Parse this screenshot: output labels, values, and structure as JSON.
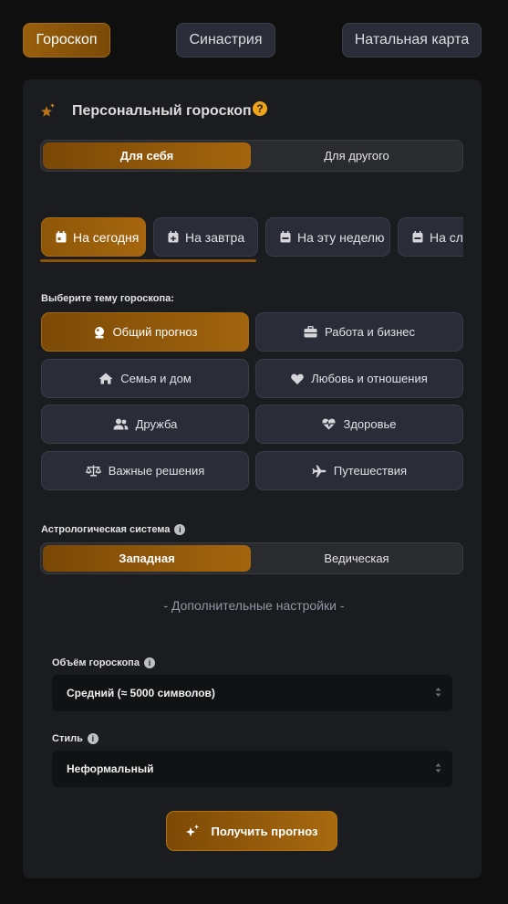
{
  "top_tabs": [
    "Гороскоп",
    "Синастрия",
    "Натальная карта"
  ],
  "card_title": "Персональный гороскоп",
  "help_icon": "?",
  "target_toggle": {
    "self": "Для себя",
    "other": "Для другого"
  },
  "date_tabs": [
    "На сегодня",
    "На завтра",
    "На эту неделю",
    "На сле"
  ],
  "topic_label": "Выберите тему гороскопа:",
  "topics": [
    {
      "label": "Общий прогноз",
      "icon": "crystal-ball-icon"
    },
    {
      "label": "Работа и бизнес",
      "icon": "briefcase-icon"
    },
    {
      "label": "Семья и дом",
      "icon": "home-icon"
    },
    {
      "label": "Любовь и отношения",
      "icon": "heart-icon"
    },
    {
      "label": "Дружба",
      "icon": "users-icon"
    },
    {
      "label": "Здоровье",
      "icon": "heart-pulse-icon"
    },
    {
      "label": "Важные решения",
      "icon": "scales-icon"
    },
    {
      "label": "Путешествия",
      "icon": "plane-icon"
    }
  ],
  "system": {
    "label": "Астрологическая система",
    "western": "Западная",
    "vedic": "Ведическая"
  },
  "additional_settings": "- Дополнительные настройки -",
  "volume": {
    "label": "Объём гороскопа",
    "value": "Средний (≈ 5000 символов)"
  },
  "style": {
    "label": "Стиль",
    "value": "Неформальный"
  },
  "cta": "Получить прогноз",
  "colors": {
    "accent": "#a3640e",
    "bg": "#0f0f10",
    "card": "#1b1c1f"
  }
}
